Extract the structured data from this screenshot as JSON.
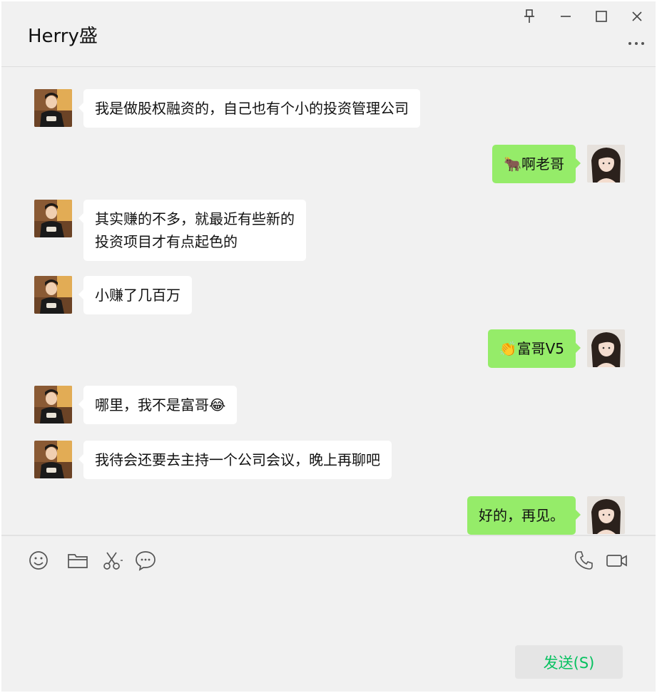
{
  "header": {
    "title": "Herry盛"
  },
  "window_controls": {
    "pin_icon": "pin-icon",
    "minimize_icon": "minimize-icon",
    "maximize_icon": "maximize-icon",
    "close_icon": "close-icon",
    "more_icon": "more-icon"
  },
  "messages": [
    {
      "side": "left",
      "text": "我是做股权融资的，自己也有个小的投资管理公司"
    },
    {
      "side": "right",
      "text": "🐂啊老哥"
    },
    {
      "side": "left",
      "text": "其实赚的不多，就最近有些新的\n投资项目才有点起色的"
    },
    {
      "side": "left",
      "text": "小赚了几百万"
    },
    {
      "side": "right",
      "text": "👏富哥V5"
    },
    {
      "side": "left",
      "text": "哪里，我不是富哥😂"
    },
    {
      "side": "left",
      "text": "我待会还要去主持一个公司会议，晚上再聊吧"
    },
    {
      "side": "right",
      "text": "好的，再见。"
    }
  ],
  "toolbar": {
    "emoji_icon": "emoji-icon",
    "folder_icon": "folder-icon",
    "screenshot_icon": "scissors-icon",
    "chat_history_icon": "chat-history-icon",
    "voice_call_icon": "phone-icon",
    "video_call_icon": "video-icon"
  },
  "composer": {
    "value": "",
    "send_label": "发送(S)"
  },
  "colors": {
    "window_bg": "#f1f1f1",
    "bubble_other": "#ffffff",
    "bubble_self": "#95ec69",
    "send_text": "#07c160",
    "send_bg": "#e5e5e5"
  }
}
